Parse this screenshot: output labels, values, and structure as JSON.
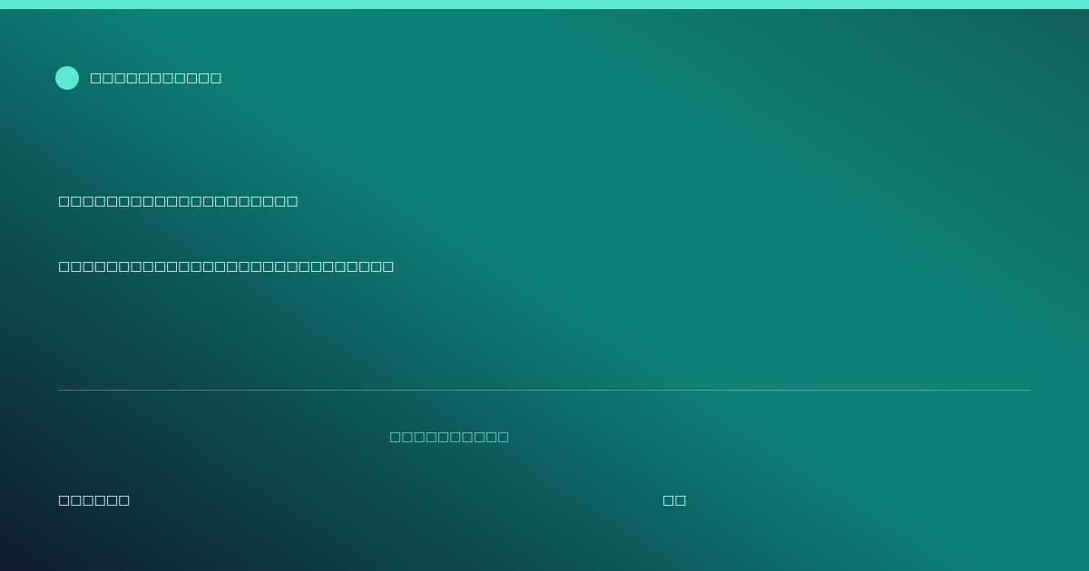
{
  "colors": {
    "accent": "#5ce8d3",
    "background_dark": "#0f1b2d",
    "background_teal": "#0d8378"
  },
  "brand": {
    "icon": "brand-dot-icon",
    "name": "□□□□□□□□□□□"
  },
  "headline": "□□□□□□□□□□□□□□□□□□□□",
  "subline": "□□□□□□□□□□□□□□□□□□□□□□□□□□□□",
  "cta_label": "□□□□□□□□□□",
  "footer": {
    "left": "□□□□□□",
    "right": "□□"
  }
}
